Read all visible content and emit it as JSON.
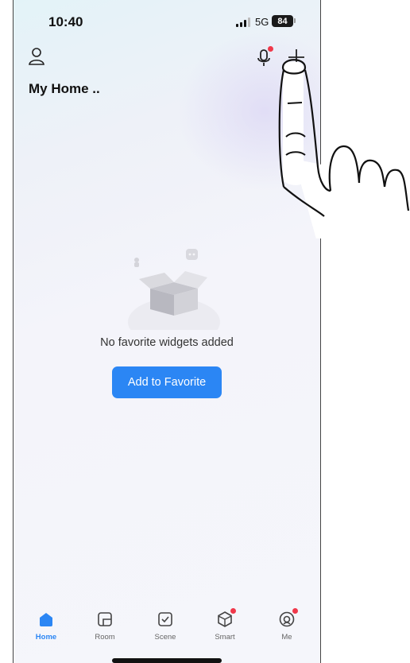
{
  "status_bar": {
    "time": "10:40",
    "network": "5G",
    "battery": "84"
  },
  "header": {
    "title": "My Home .."
  },
  "empty_state": {
    "message": "No favorite widgets added",
    "button_label": "Add to Favorite"
  },
  "tabs": [
    {
      "label": "Home",
      "icon": "home-icon",
      "active": true
    },
    {
      "label": "Room",
      "icon": "room-icon",
      "active": false
    },
    {
      "label": "Scene",
      "icon": "scene-icon",
      "active": false
    },
    {
      "label": "Smart",
      "icon": "smart-icon",
      "active": false
    },
    {
      "label": "Me",
      "icon": "me-icon",
      "active": false
    }
  ],
  "colors": {
    "accent": "#2b86f4",
    "badge": "#f0384a"
  }
}
